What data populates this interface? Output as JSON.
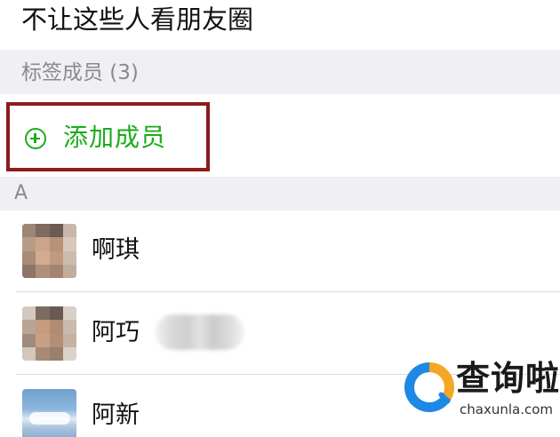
{
  "header": {
    "title": "不让这些人看朋友圈"
  },
  "tag_section": {
    "label": "标签成员 (3)"
  },
  "add_member": {
    "label": "添加成员",
    "icon": "plus-circle-icon",
    "accent_color": "#1aad19",
    "highlight_color": "#8e1c1e"
  },
  "index_section": {
    "letter": "A"
  },
  "members": [
    {
      "name": "啊琪",
      "avatar": "pixelated-face-photo"
    },
    {
      "name": "阿巧",
      "avatar": "pixelated-face-photo",
      "remark_blurred": true
    },
    {
      "name": "阿新",
      "avatar": "blue-sky-photo"
    }
  ],
  "watermark": {
    "title": "查询啦",
    "subtitle": "chaxunla.com"
  }
}
